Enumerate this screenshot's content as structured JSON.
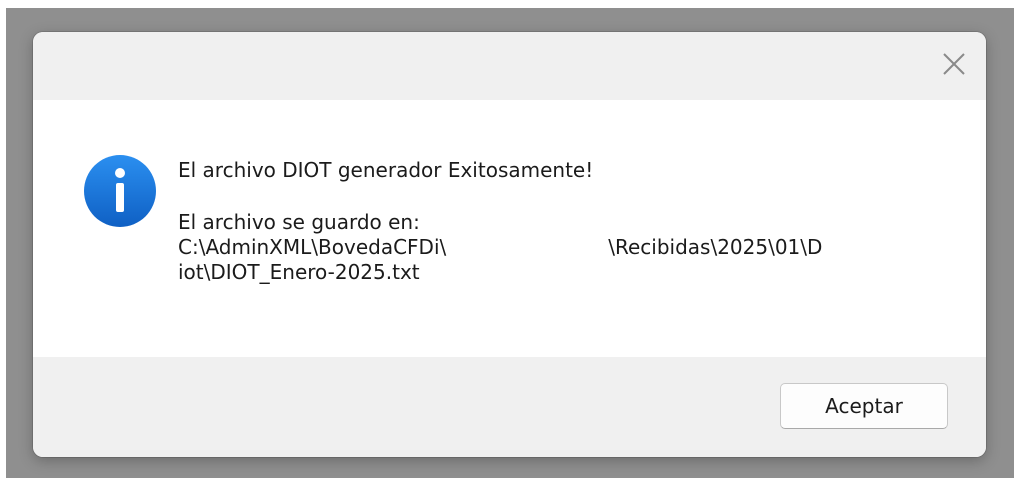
{
  "dialog": {
    "close_icon": "close-icon",
    "info_icon": "info-icon",
    "message": {
      "line1": "El archivo DIOT generador Exitosamente!",
      "line2": "El archivo se guardo en:",
      "path_start": "C:\\AdminXML\\BovedaCFDi\\",
      "path_end": "\\Recibidas\\2025\\01\\D",
      "path_line2": "iot\\DIOT_Enero-2025.txt"
    },
    "ok_button_label": "Aceptar"
  },
  "colors": {
    "info_blue": "#1673d6",
    "dialog_bg": "#f0f0f0",
    "content_bg": "#ffffff",
    "backdrop": "#8f8f8f"
  }
}
